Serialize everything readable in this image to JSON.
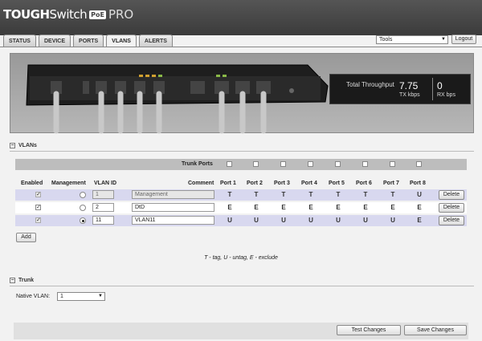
{
  "header": {
    "logo_tough": "TOUGH",
    "logo_switch": "Switch",
    "logo_poe": "PoE",
    "logo_pro": "PRO",
    "tools_value": "Tools",
    "logout_label": "Logout"
  },
  "tabs": [
    {
      "label": "STATUS"
    },
    {
      "label": "DEVICE"
    },
    {
      "label": "PORTS"
    },
    {
      "label": "VLANS",
      "active": true
    },
    {
      "label": "ALERTS"
    }
  ],
  "throughput": {
    "title": "Total Throughput",
    "tx_value": "7.75",
    "tx_label": "TX kbps",
    "rx_value": "0",
    "rx_label": "RX bps"
  },
  "vlans": {
    "section_title": "VLANs",
    "trunk_ports_label": "Trunk Ports",
    "trunk_ports_checked": [
      false,
      false,
      false,
      false,
      false,
      false,
      false,
      false
    ],
    "columns": {
      "enabled": "Enabled",
      "management": "Management",
      "vlan_id": "VLAN ID",
      "comment": "Comment",
      "ports": [
        "Port 1",
        "Port 2",
        "Port 3",
        "Port 4",
        "Port 5",
        "Port 6",
        "Port 7",
        "Port 8"
      ]
    },
    "rows": [
      {
        "enabled": true,
        "enabled_disabled": true,
        "management": false,
        "vlan_id": "1",
        "comment": "Management",
        "ports": [
          "T",
          "T",
          "T",
          "T",
          "T",
          "T",
          "T",
          "U"
        ],
        "delete_label": "Delete"
      },
      {
        "enabled": true,
        "enabled_disabled": false,
        "management": false,
        "vlan_id": "2",
        "comment": "DtD",
        "ports": [
          "E",
          "E",
          "E",
          "E",
          "E",
          "E",
          "E",
          "E"
        ],
        "delete_label": "Delete"
      },
      {
        "enabled": true,
        "enabled_disabled": true,
        "management": true,
        "vlan_id": "11",
        "comment": "VLAN11",
        "ports": [
          "U",
          "U",
          "U",
          "U",
          "U",
          "U",
          "U",
          "E"
        ],
        "delete_label": "Delete"
      }
    ],
    "add_label": "Add",
    "legend": "T - tag, U - untag, E - exclude"
  },
  "trunk": {
    "section_title": "Trunk",
    "native_vlan_label": "Native VLAN:",
    "native_vlan_value": "1"
  },
  "footer": {
    "test_label": "Test Changes",
    "save_label": "Save Changes"
  }
}
